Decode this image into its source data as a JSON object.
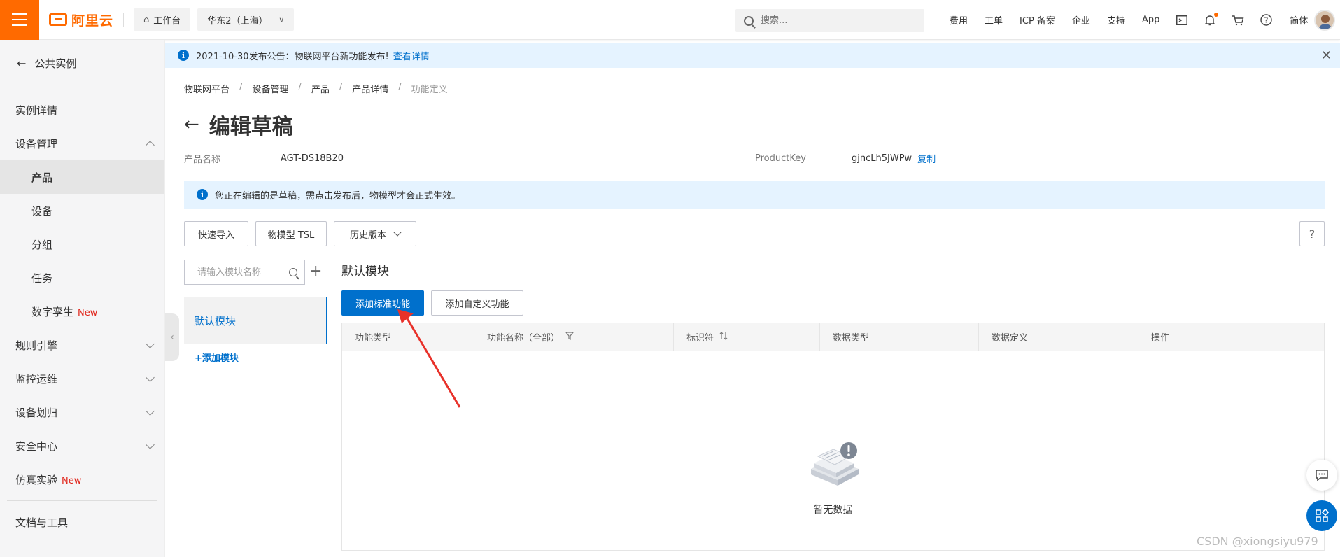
{
  "topbar": {
    "logo_text": "阿里云",
    "workbench": "工作台",
    "region": "华东2（上海）",
    "search_placeholder": "搜索...",
    "links": [
      "费用",
      "工单",
      "ICP 备案",
      "企业",
      "支持",
      "App"
    ],
    "lang": "简体"
  },
  "sidebar": {
    "back_label": "公共实例",
    "items": [
      {
        "label": "实例详情"
      },
      {
        "label": "设备管理"
      },
      {
        "label": "产品"
      },
      {
        "label": "设备"
      },
      {
        "label": "分组"
      },
      {
        "label": "任务"
      },
      {
        "label": "数字孪生",
        "badge": "New"
      },
      {
        "label": "规则引擎"
      },
      {
        "label": "监控运维"
      },
      {
        "label": "设备划归"
      },
      {
        "label": "安全中心"
      },
      {
        "label": "仿真实验",
        "badge": "New"
      },
      {
        "label": "文档与工具"
      }
    ]
  },
  "notice": {
    "text": "2021-10-30发布公告：物联网平台新功能发布!",
    "link": "查看详情"
  },
  "breadcrumb": [
    "物联网平台",
    "设备管理",
    "产品",
    "产品详情",
    "功能定义"
  ],
  "page": {
    "title": "编辑草稿",
    "product_name_label": "产品名称",
    "product_name": "AGT-DS18B20",
    "product_key_label": "ProductKey",
    "product_key": "gjncLh5JWPw",
    "copy_label": "复制",
    "draft_tip": "您正在编辑的是草稿，需点击发布后，物模型才会正式生效。"
  },
  "toolbar": {
    "quick_import": "快速导入",
    "tsl": "物模型 TSL",
    "history": "历史版本",
    "help": "?"
  },
  "modules": {
    "search_placeholder": "请输入模块名称",
    "add_icon": "+",
    "items": [
      "默认模块"
    ],
    "add_module": "+添加模块"
  },
  "section": {
    "title": "默认模块",
    "add_standard": "添加标准功能",
    "add_custom": "添加自定义功能"
  },
  "table": {
    "columns": [
      "功能类型",
      "功能名称（全部）",
      "标识符",
      "数据类型",
      "数据定义",
      "操作"
    ],
    "empty_text": "暂无数据"
  },
  "watermark": "CSDN @xiongsiyu979",
  "colors": {
    "brand": "#ff6a00",
    "primary": "#0070cc",
    "new_badge": "#e1251b",
    "annotation_arrow": "#e8312a"
  }
}
